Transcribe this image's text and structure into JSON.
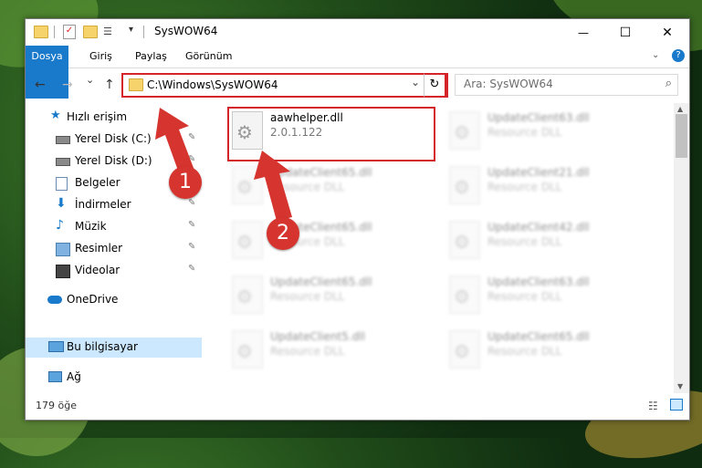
{
  "window": {
    "title": "SysWOW64",
    "controls": {
      "minimize": "—",
      "maximize": "☐",
      "close": "✕"
    }
  },
  "ribbon": {
    "tabs": [
      "Dosya",
      "Giriş",
      "Paylaş",
      "Görünüm"
    ],
    "collapse_icon": "chevron-down-icon",
    "help_icon": "?"
  },
  "nav": {
    "back": "←",
    "forward": "→",
    "recent": "⌄",
    "up": "↑",
    "address": "C:\\Windows\\SysWOW64",
    "dropdown": "⌄",
    "refresh": "↻",
    "search_placeholder": "Ara: SysWOW64",
    "search_icon": "⌕"
  },
  "sidebar": {
    "items": [
      {
        "label": "Hızlı erişim",
        "icon": "star-icon"
      },
      {
        "label": "Yerel Disk (C:)",
        "icon": "drive-icon",
        "pinned": true
      },
      {
        "label": "Yerel Disk (D:)",
        "icon": "drive-icon",
        "pinned": true
      },
      {
        "label": "Belgeler",
        "icon": "documents-icon",
        "pinned": true
      },
      {
        "label": "İndirmeler",
        "icon": "download-icon",
        "pinned": true
      },
      {
        "label": "Müzik",
        "icon": "music-icon",
        "pinned": true
      },
      {
        "label": "Resimler",
        "icon": "pictures-icon",
        "pinned": true
      },
      {
        "label": "Videolar",
        "icon": "videos-icon",
        "pinned": true
      },
      {
        "label": "OneDrive",
        "icon": "cloud-icon"
      },
      {
        "label": "Bu bilgisayar",
        "icon": "computer-icon",
        "selected": true
      },
      {
        "label": "Ağ",
        "icon": "network-icon"
      }
    ],
    "pin_glyph": "📌"
  },
  "files": [
    {
      "name": "aawhelper.dll",
      "type": "2.0.1.122",
      "highlighted": true
    },
    {
      "name": "UpdateClient63.dll",
      "type": "Resource DLL"
    },
    {
      "name": "UpdateClient65.dll",
      "type": "Resource DLL"
    },
    {
      "name": "UpdateClient21.dll",
      "type": "Resource DLL"
    },
    {
      "name": "UpdateClient65.dll",
      "type": "Resource DLL"
    },
    {
      "name": "UpdateClient42.dll",
      "type": "Resource DLL"
    },
    {
      "name": "UpdateClient65.dll",
      "type": "Resource DLL"
    },
    {
      "name": "UpdateClient63.dll",
      "type": "Resource DLL"
    },
    {
      "name": "UpdateClient5.dll",
      "type": "Resource DLL"
    },
    {
      "name": "UpdateClient65.dll",
      "type": "Resource DLL"
    }
  ],
  "status": {
    "count": "179 öğe"
  },
  "annotations": {
    "step1": "1",
    "step2": "2",
    "color": "#d6342e"
  }
}
